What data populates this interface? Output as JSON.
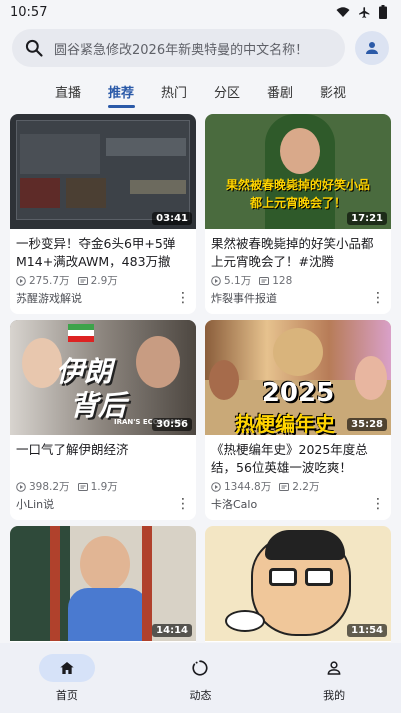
{
  "status": {
    "time": "10:57"
  },
  "search": {
    "placeholder": "圆谷紧急修改2026年新奥特曼的中文名称！"
  },
  "tabs": [
    "直播",
    "推荐",
    "热门",
    "分区",
    "番剧",
    "影视"
  ],
  "active_tab": 1,
  "videos": [
    {
      "title": "一秒变异！夺金6头6甲+5弹M14+满改AWM，483万撤离！",
      "views": "275.7万",
      "danmaku": "2.9万",
      "author": "苏醒游戏解说",
      "duration": "03:41"
    },
    {
      "title": "果然被春晚毙掉的好笑小品都上元宵晚会了！#沈腾",
      "views": "5.1万",
      "danmaku": "128",
      "author": "炸裂事件报道",
      "duration": "17:21",
      "thumb_text_1": "果然被春晚毙掉的好笑小品",
      "thumb_text_2": "都上元宵晚会了！"
    },
    {
      "title": "一口气了解伊朗经济",
      "views": "398.2万",
      "danmaku": "1.9万",
      "author": "小Lin说",
      "duration": "30:56",
      "thumb_text_1": "伊朗",
      "thumb_text_2": "背后",
      "thumb_text_3": "IRAN'S ECONOMY"
    },
    {
      "title": "《热梗编年史》2025年度总结，56位英雄一波吃爽！",
      "views": "1344.8万",
      "danmaku": "2.2万",
      "author": "卡洛Calo",
      "duration": "35:28",
      "thumb_text_1": "2025",
      "thumb_text_2": "热梗编年史"
    },
    {
      "duration": "14:14"
    },
    {
      "duration": "11:54"
    }
  ],
  "nav": [
    {
      "label": "首页",
      "icon": "home-icon"
    },
    {
      "label": "动态",
      "icon": "activity-icon"
    },
    {
      "label": "我的",
      "icon": "person-icon"
    }
  ],
  "colors": {
    "accent": "#2b5aa8",
    "thumb_yellow": "#ffd400"
  }
}
